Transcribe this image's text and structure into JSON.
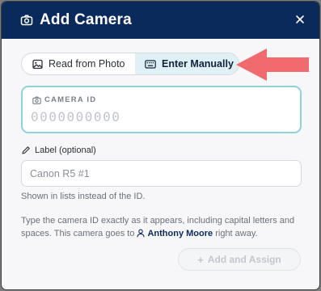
{
  "dialog": {
    "title": "Add Camera",
    "close_icon": "close-icon",
    "camera_icon": "camera-icon"
  },
  "mode_toggle": {
    "options": [
      {
        "label": "Read from Photo",
        "icon": "image-icon",
        "selected": false
      },
      {
        "label": "Enter Manually",
        "icon": "keyboard-icon",
        "selected": true
      }
    ]
  },
  "annotation": {
    "icon": "arrow-left-icon",
    "color": "#f06a6e"
  },
  "camera_id": {
    "label": "CAMERA ID",
    "placeholder": "0000000000",
    "value": ""
  },
  "label_field": {
    "label": "Label (optional)",
    "placeholder": "Canon R5 #1",
    "value": "",
    "hint": "Shown in lists instead of the ID."
  },
  "info": {
    "text_before": "Type the camera ID exactly as it appears, including capital letters and spaces. This camera goes to",
    "user_name": "Anthony Moore",
    "text_after": "right away."
  },
  "submit": {
    "label": "Add and Assign",
    "enabled": false
  },
  "colors": {
    "header": "#0b2a5c",
    "accent": "#8fd3d8",
    "selected_tab": "#dff1f4",
    "arrow": "#f06a6e"
  }
}
